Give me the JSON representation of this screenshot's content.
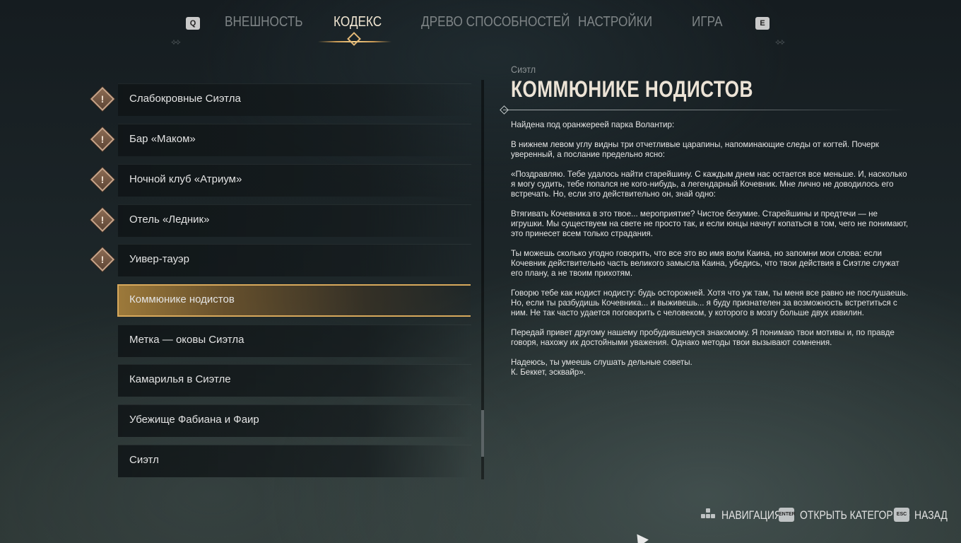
{
  "tabs": {
    "prev_key": "Q",
    "next_key": "E",
    "items": [
      {
        "label": "ВНЕШНОСТЬ"
      },
      {
        "label": "КОДЕКС"
      },
      {
        "label": "ДРЕВО СПОСОБНОСТЕЙ"
      },
      {
        "label": "НАСТРОЙКИ"
      },
      {
        "label": "ИГРА"
      }
    ],
    "active": "КОДЕКС"
  },
  "codex_list": {
    "items": [
      {
        "label": "Слабокровные Сиэтла",
        "new": true
      },
      {
        "label": "Бар «Маком»",
        "new": true
      },
      {
        "label": "Ночной клуб «Атриум»",
        "new": true
      },
      {
        "label": "Отель «Ледник»",
        "new": true
      },
      {
        "label": "Уивер-тауэр",
        "new": true
      },
      {
        "label": "Коммюнике нодистов",
        "new": false,
        "selected": true
      },
      {
        "label": "Метка — оковы Сиэтла",
        "new": false
      },
      {
        "label": "Камарилья в Сиэтле",
        "new": false
      },
      {
        "label": "Убежище Фабиана и Фаир",
        "new": false
      },
      {
        "label": "Сиэтл",
        "new": false
      }
    ],
    "new_marker": "!"
  },
  "entry": {
    "category": "Сиэтл",
    "title": "КОММЮНИКЕ НОДИСТОВ",
    "paragraphs": [
      "Найдена под оранжереей парка Волантир:",
      "В нижнем левом углу видны три отчетливые царапины, напоминающие следы от когтей. Почерк уверенный, а послание предельно ясно:",
      "«Поздравляю. Тебе удалось найти старейшину. С каждым днем нас остается все меньше. И, насколько я могу судить, тебе попался не кого-нибудь, а легендарный Кочевник. Мне лично не доводилось его встречать. Но, если это действительно он, знай одно:",
      "Втягивать Кочевника в это твое... мероприятие? Чистое безумие. Старейшины и предтечи — не игрушки. Мы существуем на свете не просто так, и если юнцы начнут копаться в том, чего не понимают, это принесет всем только страдания.",
      "Ты можешь сколько угодно говорить, что все это во имя воли Каина, но запомни мои слова: если Кочевник действительно часть великого замысла Каина, убедись, что твои действия в Сиэтле служат его плану, а не твоим прихотям.",
      "Говорю тебе как нодист нодисту: будь осторожней. Хотя что уж там, ты меня все равно не послушаешь. Но, если ты разбудишь Кочевника... и выживешь... я буду признателен за возможность встретиться с ним. Не так часто удается поговорить с человеком, у которого в мозгу больше двух извилин.",
      "Передай привет другому нашему пробудившемуся знакомому. Я понимаю твои мотивы и, по правде говоря, нахожу их достойными уважения. Однако методы твои вызывают сомнения."
    ],
    "closing_line1": "Надеюсь, ты умеешь слушать дельные советы.",
    "closing_line2": "К. Беккет, эсквайр»."
  },
  "hints": {
    "navigate_label": "НАВИГАЦИЯ",
    "open_key": "ENTER",
    "open_label": "ОТКРЫТЬ КАТЕГОРИЮ",
    "back_key": "ESC",
    "back_label": "НАЗАД"
  },
  "colors": {
    "accent_gold": "#d8a95c",
    "active_tab_text": "#f1e6d2",
    "inactive_tab_text": "#7e8486"
  }
}
